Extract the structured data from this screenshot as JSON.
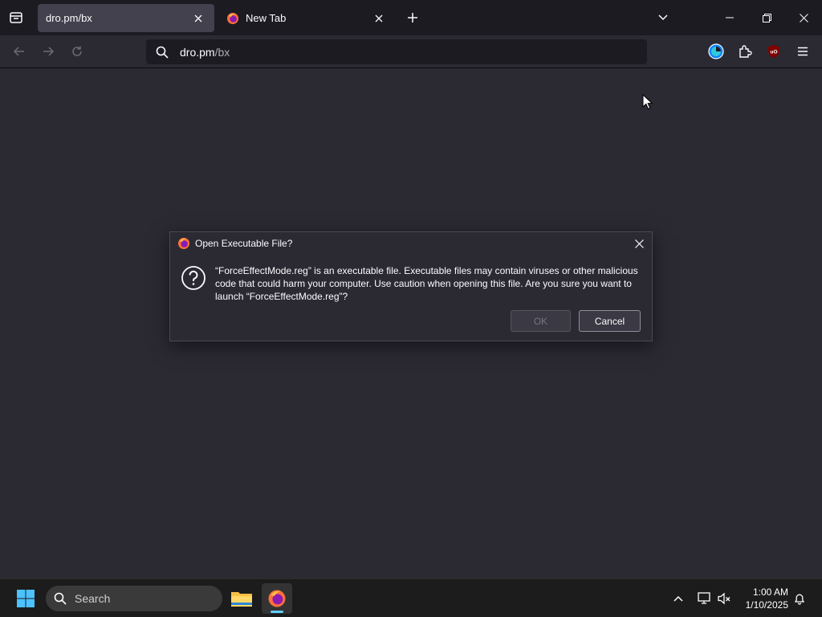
{
  "browser": {
    "tabs": [
      {
        "title": "dro.pm/bx",
        "active": true
      },
      {
        "title": "New Tab",
        "active": false
      }
    ],
    "url": {
      "host": "dro.pm",
      "path": "/bx"
    }
  },
  "dialog": {
    "title": "Open Executable File?",
    "message": "“ForceEffectMode.reg” is an executable file. Executable files may contain viruses or other malicious code that could harm your computer. Use caution when opening this file. Are you sure you want to launch “ForceEffectMode.reg”?",
    "ok_label": "OK",
    "cancel_label": "Cancel"
  },
  "taskbar": {
    "search_label": "Search",
    "time": "1:00 AM",
    "date": "1/10/2025"
  },
  "colors": {
    "chrome_dark": "#1c1b22",
    "chrome": "#2b2a33",
    "active_tab": "#42414d",
    "taskbar": "#1c1c1c",
    "accent_blue": "#60cdff"
  }
}
